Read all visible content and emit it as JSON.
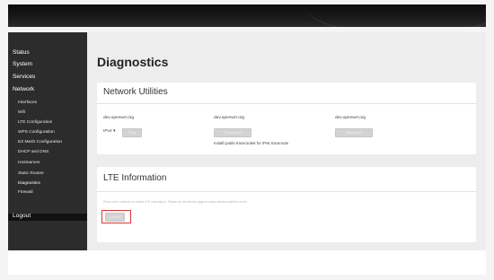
{
  "sidebar": {
    "items": [
      {
        "label": "Status"
      },
      {
        "label": "System"
      },
      {
        "label": "Services"
      },
      {
        "label": "Network"
      }
    ],
    "subitems": [
      {
        "label": "Interfaces"
      },
      {
        "label": "Wifi"
      },
      {
        "label": "LTE Configuration"
      },
      {
        "label": "WPS Configuration"
      },
      {
        "label": "EZ Mesh Configuration"
      },
      {
        "label": "DHCP and DNS"
      },
      {
        "label": "Hostnames"
      },
      {
        "label": "Static Routes"
      },
      {
        "label": "Diagnostics"
      },
      {
        "label": "Firewall"
      }
    ],
    "logout": "Logout"
  },
  "main": {
    "title": "Diagnostics",
    "network_utilities": {
      "title": "Network Utilities",
      "ping": {
        "host": "dev.openwrt.org",
        "select_value": "IPv4",
        "select_arrow": "▾",
        "button": "Ping"
      },
      "traceroute": {
        "host": "dev.openwrt.org",
        "button": "Traceroute",
        "hint": "Install iputils-traceroute6 for IPv6 traceroute"
      },
      "nslookup": {
        "host": "dev.openwrt.org",
        "button": "Nslookup"
      }
    },
    "lte_information": {
      "title": "LTE Information",
      "description": "Press a lter Instance to collect LTE information. Please do not refresh page or close window until the event.",
      "button": "Collect"
    }
  },
  "colors": {
    "sidebar_bg": "#2c2c2c",
    "active_item_bg": "#121212",
    "highlight": "#d9383a",
    "button_bg": "#d3d3d3"
  }
}
